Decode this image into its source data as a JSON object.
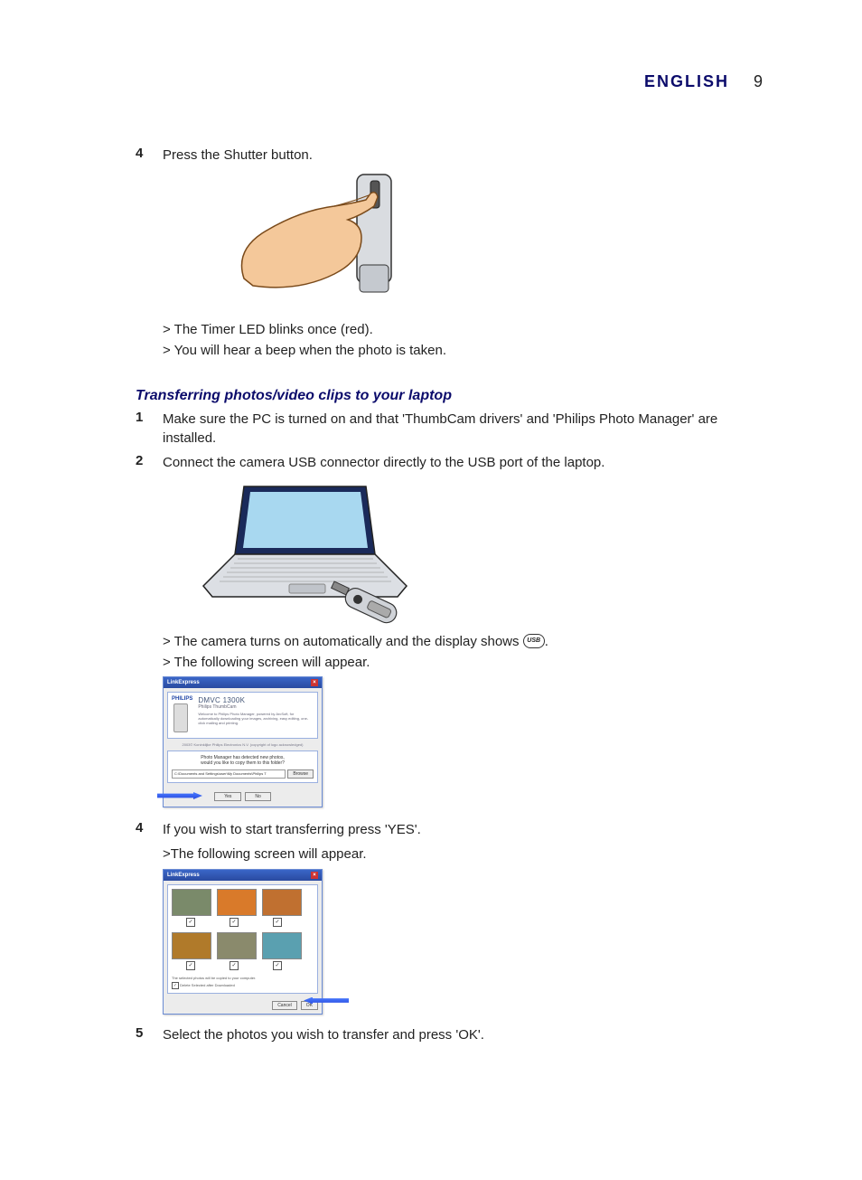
{
  "header": {
    "language": "ENGLISH",
    "page_number": "9"
  },
  "step4": {
    "num": "4",
    "text": "Press the Shutter button.",
    "result1": "> The Timer LED blinks once (red).",
    "result2": "> You will hear a beep when the photo is taken."
  },
  "section_title": "Transferring photos/video clips to your laptop",
  "t1": {
    "num": "1",
    "text": "Make sure the PC is turned on and that 'ThumbCam drivers' and 'Philips Photo Manager' are installed."
  },
  "t2": {
    "num": "2",
    "text": "Connect the camera USB connector directly to the USB port of the laptop.",
    "result1_pre": "> The camera turns on automatically and the display shows ",
    "result1_usb": "USB",
    "result1_post": ".",
    "result2": "> The following screen will appear."
  },
  "dialog1": {
    "title": "LinkExpress",
    "brand": "PHILIPS",
    "model": "DMVC 1300K",
    "subtitle": "Philips ThumbCam",
    "desc": "Welcome to Philips Photo Manager, powered by ArcSoft, for automatically downloading your images, archiving, easy editing, one-click mailing and printing.",
    "copyright": "2003© Koninklijke Philips Electronics N.V. (copyright of logo acknowledged)",
    "msg1": "Photo Manager has detected new photos,",
    "msg2": "would you like to copy them to this folder?",
    "path": "C:\\Documents and Settings\\user\\My Documents\\Philips T",
    "browse": "Browse",
    "yes": "Yes",
    "no": "No"
  },
  "t4b": {
    "num": "4",
    "text": "If you wish to start transferring press 'YES'.",
    "result": ">The following screen will appear."
  },
  "dialog2": {
    "title": "LinkExpress",
    "msg": "The selected photos will be copied to your computer.",
    "delete_label": "Delete Selected after Downloaded",
    "cancel": "Cancel",
    "ok": "OK",
    "thumb_colors": [
      "#7a8a6a",
      "#d97a2a",
      "#c07030",
      "#b07a2a",
      "#8a8a6c",
      "#5aa0b0"
    ]
  },
  "t5": {
    "num": "5",
    "text": "Select the photos you wish to transfer and press 'OK'."
  }
}
